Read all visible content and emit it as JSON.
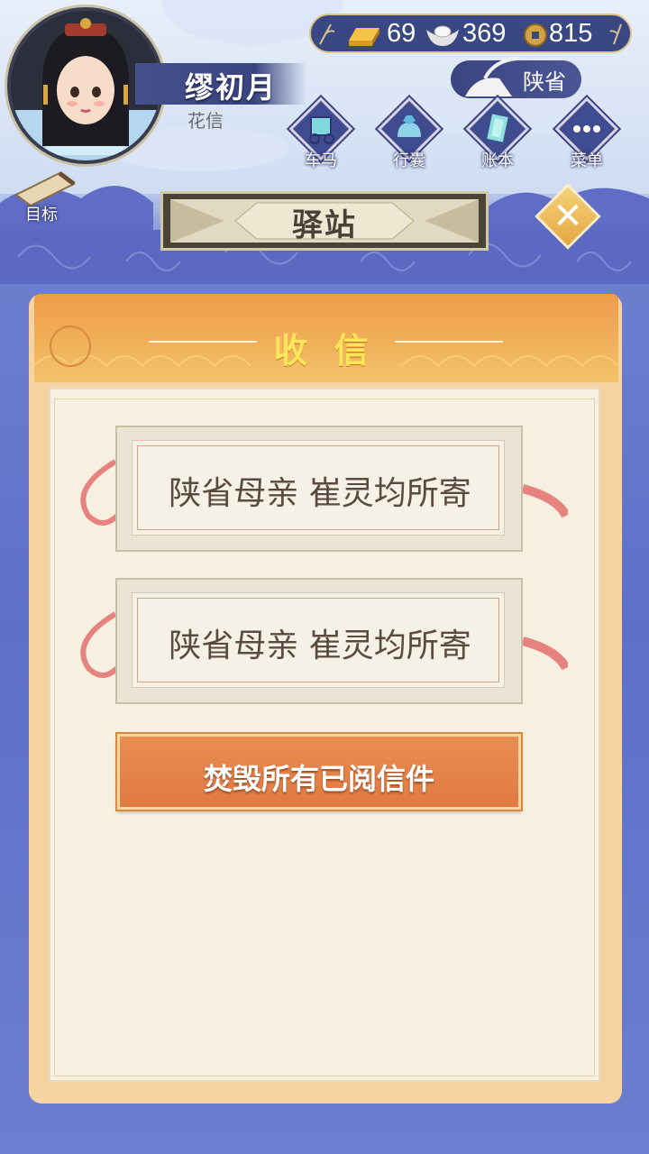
{
  "player": {
    "name": "缪初月",
    "subtitle": "花信"
  },
  "currency": {
    "gold": "69",
    "silver": "369",
    "coins": "815"
  },
  "location": "陕省",
  "menu": {
    "carriage": "车马",
    "bag": "行囊",
    "ledger": "账本",
    "more": "菜单",
    "target": "目标"
  },
  "page_title": "驿站",
  "panel": {
    "title": "收 信",
    "letters": [
      {
        "label": "陕省母亲 崔灵均所寄"
      },
      {
        "label": "陕省母亲 崔灵均所寄"
      }
    ],
    "burn_label": "焚毁所有已阅信件"
  },
  "colors": {
    "accent_orange": "#e98d52",
    "title_yellow": "#fde65a",
    "navy": "#3a4580"
  }
}
